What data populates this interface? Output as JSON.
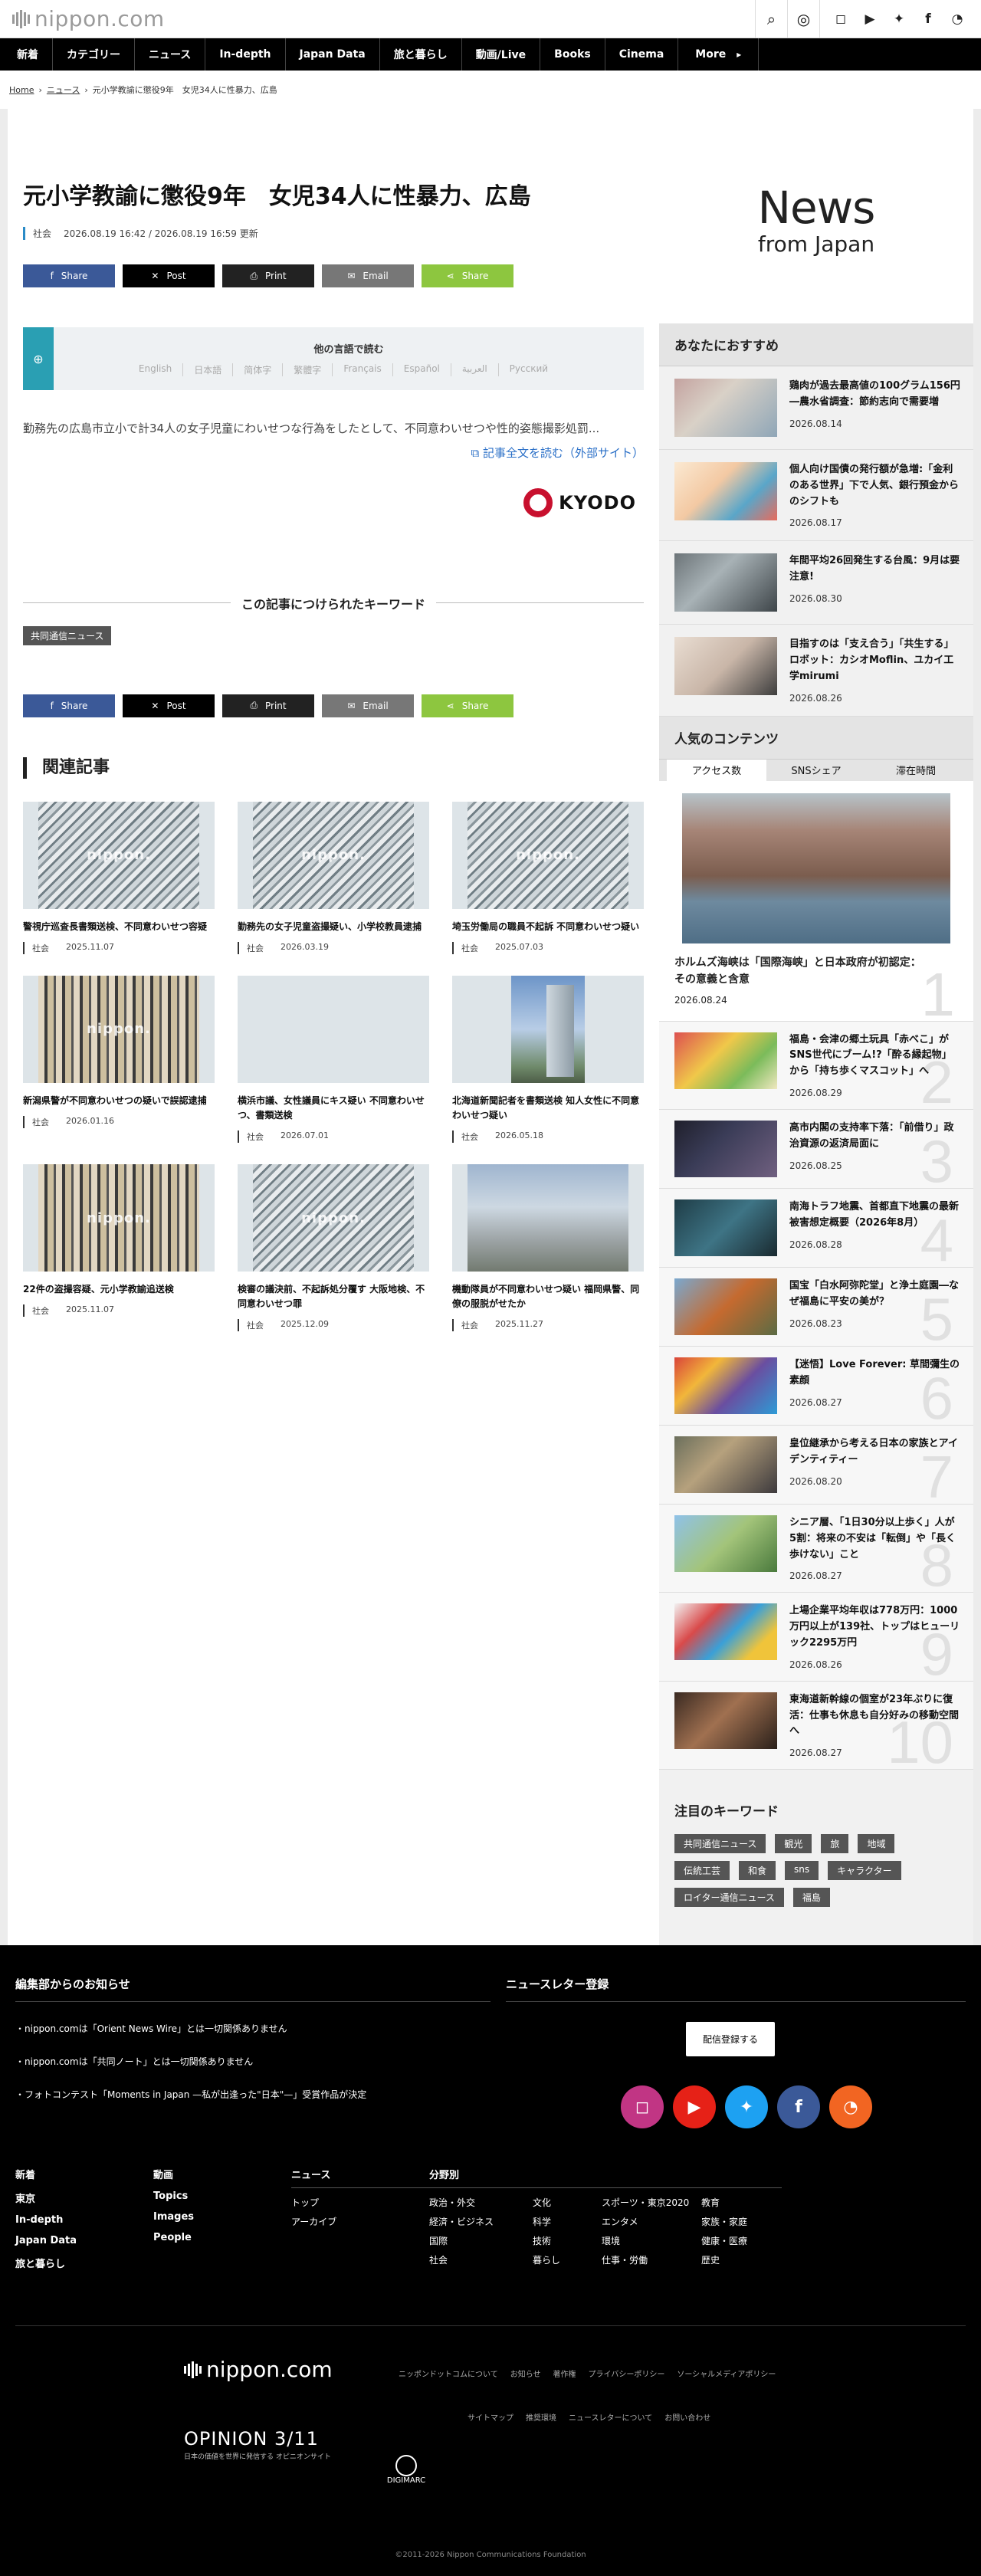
{
  "header": {
    "logo": "nippon.com",
    "icons": [
      "search-icon",
      "globe-icon",
      "instagram-icon",
      "youtube-icon",
      "twitter-icon",
      "facebook-icon",
      "rss-icon"
    ]
  },
  "nav": [
    "新着",
    "カテゴリー",
    "ニュース",
    "In-depth",
    "Japan Data",
    "旅と暮らし",
    "動画/Live",
    "Books",
    "Cinema"
  ],
  "nav_more": "More",
  "breadcrumb": [
    "Home",
    "ニュース",
    "元小学教諭に懲役9年　女児34人に性暴力、広島"
  ],
  "article": {
    "title": "元小学教諭に懲役9年　女児34人に性暴力、広島",
    "category": "社会",
    "date": "2026.08.19 16:42 / 2026.08.19 16:59 更新",
    "share": {
      "facebook": "Share",
      "x": "Post",
      "print": "Print",
      "email": "Email",
      "share": "Share"
    },
    "other_lang_head": "他の言語で読む",
    "languages": [
      "English",
      "日本語",
      "简体字",
      "繁體字",
      "Français",
      "Español",
      "العربية",
      "Русский"
    ],
    "lead": "勤務先の広島市立小で計34人の女子児童にわいせつな行為をしたとして、不同意わいせつや性的姿態撮影処罰...",
    "read_full": "記事全文を読む（外部サイト）",
    "source": "KYODO",
    "keywords_head": "この記事につけられたキーワード",
    "keywords": [
      "共同通信ニュース"
    ]
  },
  "related": {
    "head": "関連記事",
    "watermark": "nippon.",
    "items": [
      {
        "title": "警視庁巡査長書類送検、不同意わいせつ容疑",
        "cat": "社会",
        "date": "2025.11.07"
      },
      {
        "title": "勤務先の女子児童盗撮疑い、小学校教員逮捕",
        "cat": "社会",
        "date": "2026.03.19"
      },
      {
        "title": "埼玉労働局の職員不起訴 不同意わいせつ疑い",
        "cat": "社会",
        "date": "2025.07.03"
      },
      {
        "title": "新潟県警が不同意わいせつの疑いで誤認逮捕",
        "cat": "社会",
        "date": "2026.01.16"
      },
      {
        "title": "横浜市議、女性議員にキス疑い 不同意わいせつ、書類送検",
        "cat": "社会",
        "date": "2026.07.01"
      },
      {
        "title": "北海道新聞記者を書類送検 知人女性に不同意わいせつ疑い",
        "cat": "社会",
        "date": "2026.05.18"
      },
      {
        "title": "22件の盗撮容疑、元小学教諭追送検",
        "cat": "社会",
        "date": "2025.11.07"
      },
      {
        "title": "検審の議決前、不起訴処分覆す 大阪地検、不同意わいせつ罪",
        "cat": "社会",
        "date": "2025.12.09"
      },
      {
        "title": "機動隊員が不同意わいせつ疑い 福岡県警、同僚の服脱がせたか",
        "cat": "社会",
        "date": "2025.11.27"
      }
    ]
  },
  "sidebar": {
    "news_logo_1": "News",
    "news_logo_2": "from Japan",
    "recommend_head": "あなたにおすすめ",
    "recommend": [
      {
        "title": "鶏肉が過去最高値の100グラム156円―農水省調査：節約志向で需要増",
        "date": "2026.08.14"
      },
      {
        "title": "個人向け国債の発行額が急増:「金利のある世界」下で人気、銀行預金からのシフトも",
        "date": "2026.08.17"
      },
      {
        "title": "年間平均26回発生する台風：9月は要注意!",
        "date": "2026.08.30"
      },
      {
        "title": "目指すのは「支え合う」「共生する」ロボット：カシオMoflin、ユカイ工学mirumi",
        "date": "2026.08.26"
      }
    ],
    "popular_head": "人気のコンテンツ",
    "tabs": [
      "アクセス数",
      "SNSシェア",
      "滞在時間"
    ],
    "popular": [
      {
        "rank": "1",
        "title": "ホルムズ海峡は「国際海峡」と日本政府が初認定：その意義と含意",
        "date": "2026.08.24"
      },
      {
        "rank": "2",
        "title": "福島・会津の郷土玩具「赤べこ」がSNS世代にブーム!?「酔る縁起物」から「持ち歩くマスコット」へ",
        "date": "2026.08.29"
      },
      {
        "rank": "3",
        "title": "高市内閣の支持率下落：「前借り」政治資源の返済局面に",
        "date": "2026.08.25"
      },
      {
        "rank": "4",
        "title": "南海トラフ地震、首都直下地震の最新被害想定概要（2026年8月）",
        "date": "2026.08.28"
      },
      {
        "rank": "5",
        "title": "国宝「白水阿弥陀堂」と浄土庭園―なぜ福島に平安の美が？",
        "date": "2026.08.23"
      },
      {
        "rank": "6",
        "title": "【迷悟】Love Forever: 草間彌生の素顔",
        "date": "2026.08.27"
      },
      {
        "rank": "7",
        "title": "皇位継承から考える日本の家族とアイデンティティー",
        "date": "2026.08.20"
      },
      {
        "rank": "8",
        "title": "シニア層、「1日30分以上歩く」人が5割：将来の不安は「転倒」や「長く歩けない」こと",
        "date": "2026.08.27"
      },
      {
        "rank": "9",
        "title": "上場企業平均年収は778万円：1000万円以上が139社、トップはヒューリック2295万円",
        "date": "2026.08.26"
      },
      {
        "rank": "10",
        "title": "東海道新幹線の個室が23年ぶりに復活：仕事も休息も自分好みの移動空間へ",
        "date": "2026.08.27"
      }
    ],
    "kw_head": "注目のキーワード",
    "kw": [
      "共同通信ニュース",
      "観光",
      "旅",
      "地域",
      "伝統工芸",
      "和食",
      "sns",
      "キャラクター",
      "ロイター通信ニュース",
      "福島"
    ]
  },
  "footer": {
    "notice_head": "編集部からのお知らせ",
    "notices": [
      "・nippon.comは「Orient News Wire」とは一切関係ありません",
      "・nippon.comは「共同ノート」とは一切関係ありません",
      "・フォトコンテスト「Moments in Japan —私が出逢った\"日本\"—」受賞作品が決定"
    ],
    "newsletter_head": "ニュースレター登録",
    "newsletter_btn": "配信登録する",
    "col1": [
      "新着",
      "東京",
      "In-depth",
      "Japan Data",
      "旅と暮らし"
    ],
    "col2": [
      "動画",
      "Topics",
      "Images",
      "People"
    ],
    "col3_head": "ニュース",
    "col3": [
      "トップ",
      "アーカイブ"
    ],
    "col4_head": "分野別",
    "col4": [
      "政治・外交",
      "文化",
      "スポーツ・東京2020",
      "教育",
      "経済・ビジネス",
      "科学",
      "エンタメ",
      "家族・家庭",
      "国際",
      "技術",
      "環境",
      "健康・医療",
      "社会",
      "暮らし",
      "仕事・労働",
      "歴史"
    ],
    "logo": "nippon.com",
    "links_1": [
      "ニッポンドットコムについて",
      "お知らせ",
      "著作権",
      "プライバシーポリシー",
      "ソーシャルメディアポリシー"
    ],
    "links_2": [
      "サイトマップ",
      "推奨環境",
      "ニュースレターについて",
      "お問い合わせ"
    ],
    "opinion": "OPINION 3/11",
    "opinion_sub": "日本の価値を世界に発信する オピニオンサイト",
    "digimarc": "DIGIMARC",
    "copyright": "©2011-2026 Nippon Communications Foundation"
  }
}
